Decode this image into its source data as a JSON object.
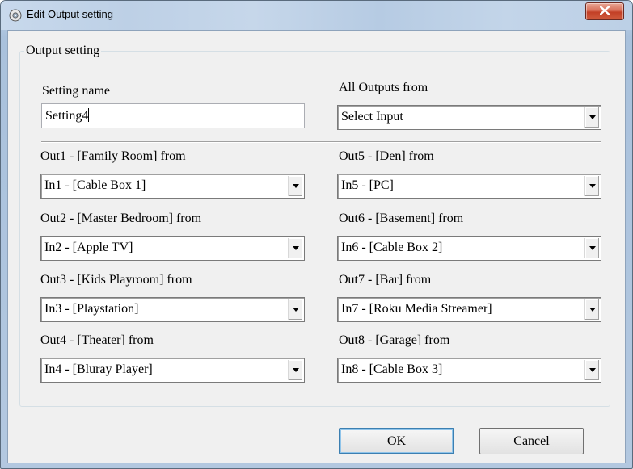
{
  "window": {
    "title": "Edit Output setting"
  },
  "group": {
    "label": "Output setting"
  },
  "setting_name": {
    "label": "Setting name",
    "value": "Setting4"
  },
  "all_outputs": {
    "label": "All Outputs from",
    "value": "Select Input"
  },
  "outputs": [
    {
      "label": "Out1 - [Family Room] from",
      "value": "In1 - [Cable Box 1]"
    },
    {
      "label": "Out2 - [Master Bedroom] from",
      "value": "In2 - [Apple TV]"
    },
    {
      "label": "Out3 - [Kids Playroom] from",
      "value": "In3 - [Playstation]"
    },
    {
      "label": "Out4 - [Theater] from",
      "value": "In4 - [Bluray Player]"
    },
    {
      "label": "Out5 - [Den] from",
      "value": "In5 - [PC]"
    },
    {
      "label": "Out6 - [Basement] from",
      "value": "In6 - [Cable Box 2]"
    },
    {
      "label": "Out7 - [Bar] from",
      "value": "In7 - [Roku Media Streamer]"
    },
    {
      "label": "Out8 - [Garage] from",
      "value": "In8 - [Cable Box 3]"
    }
  ],
  "buttons": {
    "ok": "OK",
    "cancel": "Cancel"
  },
  "icons": {
    "app": "app-disc-icon",
    "close": "close-icon",
    "dropdown": "chevron-down-icon"
  }
}
